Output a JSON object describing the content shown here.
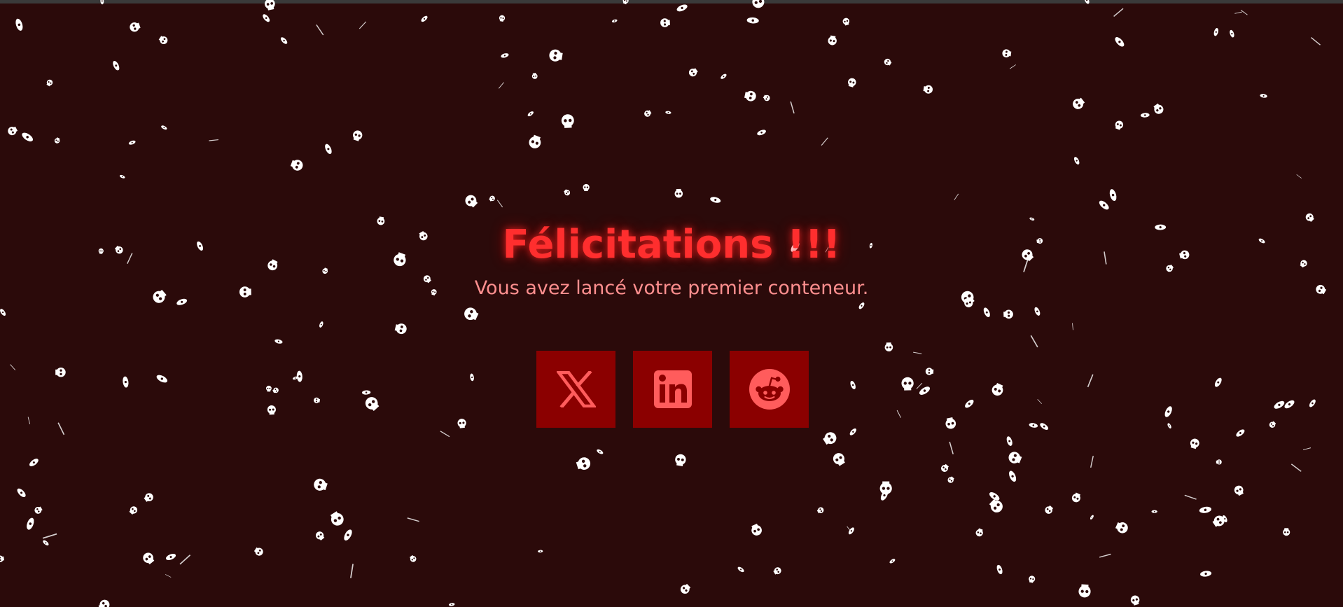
{
  "hero": {
    "title": "Félicitations !!!",
    "subtitle": "Vous avez lancé votre premier conteneur."
  },
  "social_buttons": [
    {
      "network": "X",
      "icon": "x-logo-icon"
    },
    {
      "network": "LinkedIn",
      "icon": "linkedin-logo-icon"
    },
    {
      "network": "Reddit",
      "icon": "reddit-logo-icon"
    }
  ],
  "colors": {
    "background": "#2b0a0a",
    "title": "#ff2e2e",
    "subtitle": "#ff8f8f",
    "button_bg": "#8b0000",
    "icon": "#ff5c5c",
    "particle": "#ffffff"
  },
  "decor": {
    "particle_icon": "falling-skull-icon"
  }
}
